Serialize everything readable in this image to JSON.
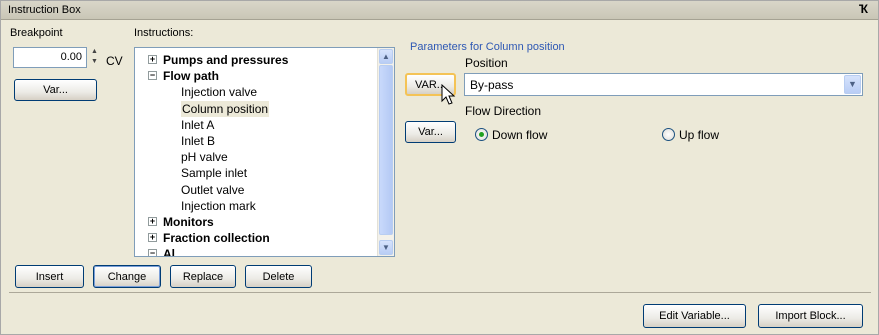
{
  "window": {
    "title": "Instruction Box",
    "pin_icon": "pin-icon"
  },
  "breakpoint": {
    "label": "Breakpoint",
    "value": "0.00",
    "unit": "CV",
    "var_button": "Var..."
  },
  "instructions": {
    "label": "Instructions:",
    "items": [
      {
        "text": "Pumps and pressures",
        "type": "group",
        "expander": "+"
      },
      {
        "text": "Flow path",
        "type": "group",
        "expander": "-"
      },
      {
        "text": "Injection valve",
        "type": "leaf"
      },
      {
        "text": "Column position",
        "type": "leaf",
        "selected": true
      },
      {
        "text": "Inlet A",
        "type": "leaf"
      },
      {
        "text": "Inlet B",
        "type": "leaf"
      },
      {
        "text": "pH valve",
        "type": "leaf"
      },
      {
        "text": "Sample inlet",
        "type": "leaf"
      },
      {
        "text": "Outlet valve",
        "type": "leaf"
      },
      {
        "text": "Injection mark",
        "type": "leaf"
      },
      {
        "text": "Monitors",
        "type": "group",
        "expander": "+"
      },
      {
        "text": "Fraction collection",
        "type": "group",
        "expander": "+"
      },
      {
        "text": "Al...",
        "type": "group",
        "expander": "-"
      }
    ]
  },
  "parameters": {
    "title": "Parameters for Column position",
    "position_label": "Position",
    "var_button_1": "VAR...",
    "position_value": "By-pass",
    "flow_direction_label": "Flow Direction",
    "var_button_2": "Var...",
    "radio_down": "Down flow",
    "radio_up": "Up flow",
    "selected_direction": "Down flow"
  },
  "actions": {
    "insert": "Insert",
    "change": "Change",
    "replace": "Replace",
    "delete": "Delete"
  },
  "footer": {
    "edit_variable": "Edit Variable...",
    "import_block": "Import Block..."
  }
}
